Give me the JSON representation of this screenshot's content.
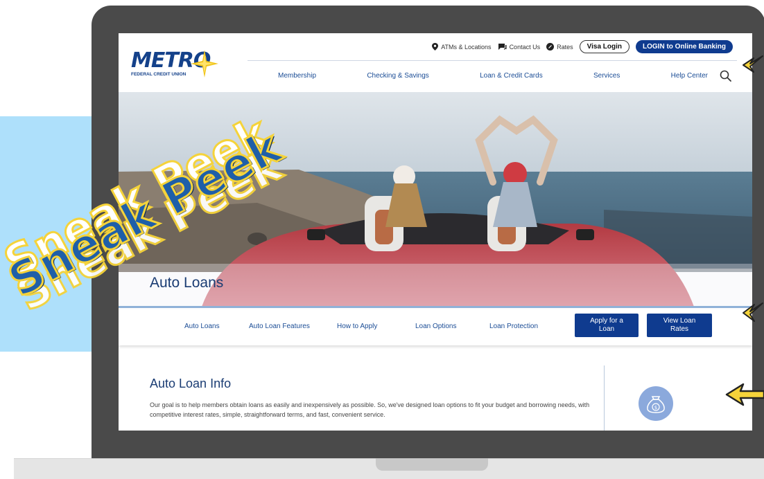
{
  "decor": {
    "sticker_text": "Sneak Peek",
    "accent_blue": "#0f3b8f",
    "sticker_yellow": "#f5d33a",
    "panel_blue": "#aee0fb"
  },
  "logo": {
    "word": "METRO",
    "subtitle": "FEDERAL CREDIT UNION"
  },
  "utility": {
    "atms": "ATMs & Locations",
    "contact": "Contact Us",
    "rates": "Rates",
    "visa_login": "Visa Login",
    "online_banking": "LOGIN to Online Banking"
  },
  "nav": {
    "items": [
      "Membership",
      "Checking & Savings",
      "Loan & Credit Cards",
      "Services",
      "Help Center"
    ]
  },
  "hero": {
    "title": "Auto Loans"
  },
  "subnav": {
    "links": [
      "Auto Loans",
      "Auto Loan Features",
      "How to Apply",
      "Loan Options",
      "Loan Protection"
    ],
    "apply_line1": "Apply for a",
    "apply_line2": "Loan",
    "rates_line1": "View Loan",
    "rates_line2": "Rates"
  },
  "content": {
    "title": "Auto Loan Info",
    "body": "Our goal is to help members obtain loans as easily and inexpensively as possible. So, we've designed loan options to fit your budget and borrowing needs, with competitive interest rates, simple, straightforward terms, and fast, convenient service."
  }
}
